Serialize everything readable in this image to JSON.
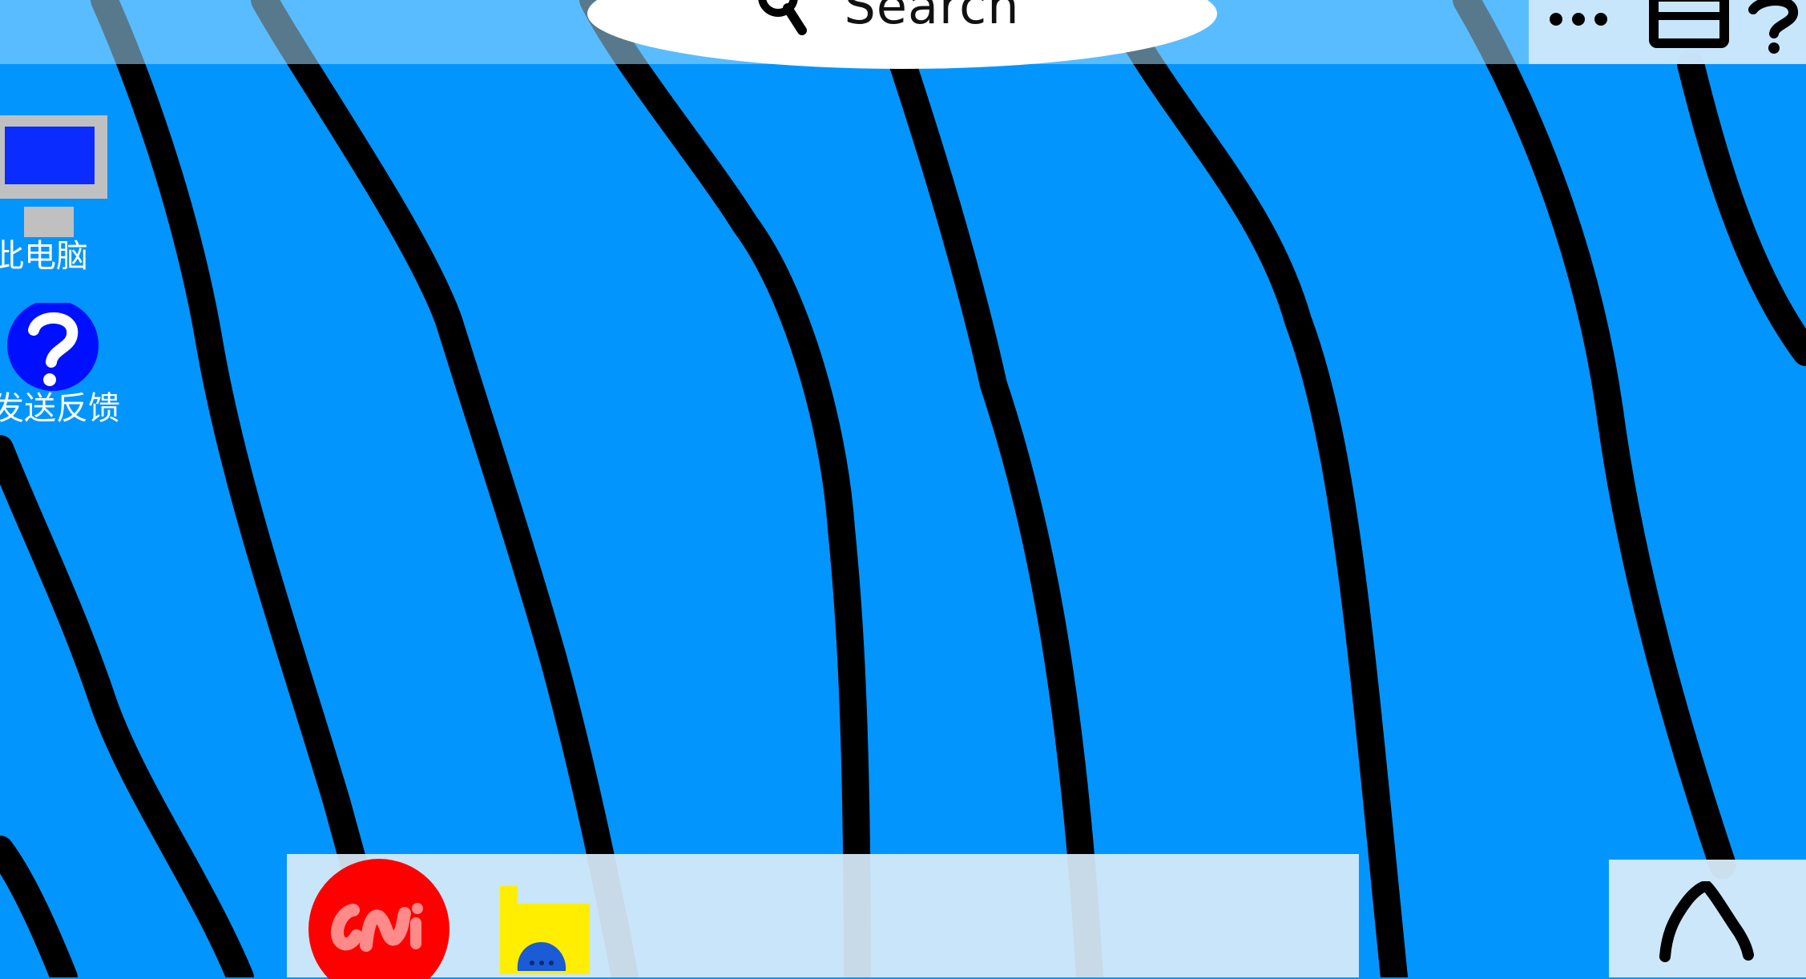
{
  "colors": {
    "desktop_background": "#0395fe",
    "wallpaper_lines": "#000000",
    "top_bar": "#a0dcff",
    "search_pill": "#ffffff",
    "taskbar": "#d7ebfa",
    "app_red": "#ff0000",
    "app_red_letters": "#ff8a8a",
    "folder": "#ffee00",
    "folder_blob": "#1a5bd6",
    "pc_screen": "#0a2cff",
    "pc_stand": "#c0c0c0",
    "feedback_circle": "#0010ff"
  },
  "search": {
    "label": "Search",
    "icon": "search-icon"
  },
  "top_right": {
    "icons": [
      "more-icon",
      "window-icon",
      "help-icon"
    ]
  },
  "desktop": {
    "icons": [
      {
        "label": "此电脑",
        "icon": "computer-icon"
      },
      {
        "label": "发送反馈",
        "icon": "feedback-icon"
      }
    ]
  },
  "taskbar": {
    "apps": [
      {
        "icon": "red-app-icon"
      },
      {
        "icon": "folder-icon"
      }
    ],
    "tray": {
      "icon": "chevron-up-icon"
    }
  }
}
